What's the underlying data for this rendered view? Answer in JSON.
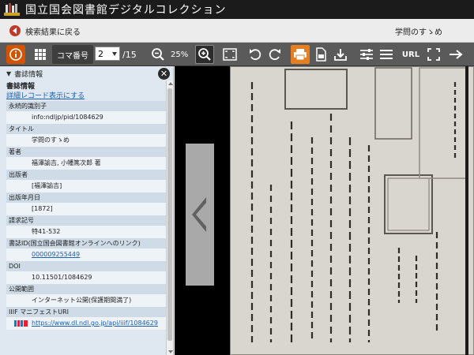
{
  "app": {
    "title": "国立国会図書館デジタルコレクション"
  },
  "nav": {
    "back_label": "検索結果に戻る",
    "book_title": "学問のすゝめ"
  },
  "toolbar": {
    "frame_label": "コマ番号",
    "frame_value": "2",
    "frame_total": "/15",
    "zoom_level": "25%",
    "url_label": "URL",
    "accent_color": "#e67e22",
    "info_color": "#d35400"
  },
  "sidebar": {
    "header": "書誌情報",
    "section_title": "書誌情報",
    "detail_link": "詳細レコード表示にする",
    "fields": [
      {
        "label": "永続的識別子",
        "value": "info:ndljp/pid/1084629"
      },
      {
        "label": "タイトル",
        "value": "学問のすゝめ"
      },
      {
        "label": "著者",
        "value": "福澤諭吉, 小幡篤次郎 著"
      },
      {
        "label": "出版者",
        "value": "[福澤諭吉]"
      },
      {
        "label": "出版年月日",
        "value": "[1872]"
      },
      {
        "label": "請求記号",
        "value": "特41-532"
      },
      {
        "label": "書誌ID(国立国会図書館オンラインへのリンク)",
        "value": "000009255449"
      },
      {
        "label": "DOI",
        "value": "10.11501/1084629"
      },
      {
        "label": "公開範囲",
        "value": "インターネット公開(保護期間満了)"
      },
      {
        "label": "IIIF マニフェストURI",
        "value": "https://www.dl.ndl.go.jp/api/iiif/1084629"
      }
    ]
  }
}
